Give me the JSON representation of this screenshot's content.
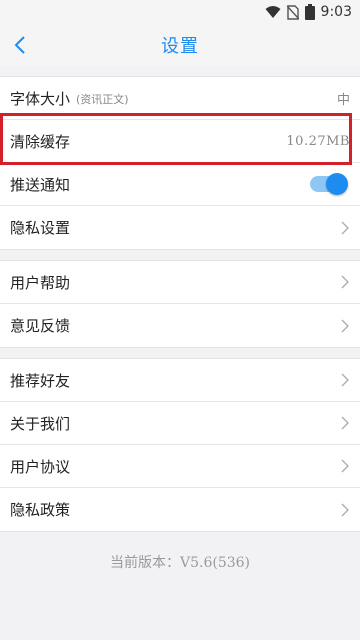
{
  "status_bar": {
    "time": "9:03",
    "battery_level": "8"
  },
  "nav": {
    "title": "设置"
  },
  "groups": [
    {
      "rows": [
        {
          "label": "字体大小",
          "sub": "(资讯正文)",
          "value": "中"
        },
        {
          "label": "清除缓存",
          "value": "10.27MB"
        },
        {
          "label": "推送通知",
          "toggle_on": true
        },
        {
          "label": "隐私设置"
        }
      ]
    },
    {
      "rows": [
        {
          "label": "用户帮助"
        },
        {
          "label": "意见反馈"
        }
      ]
    },
    {
      "rows": [
        {
          "label": "推荐好友"
        },
        {
          "label": "关于我们"
        },
        {
          "label": "用户协议"
        },
        {
          "label": "隐私政策"
        }
      ]
    }
  ],
  "footer": {
    "version_text": "当前版本：V5.6(536)"
  },
  "colors": {
    "accent": "#1d8cf0",
    "highlight": "#d4202a"
  }
}
